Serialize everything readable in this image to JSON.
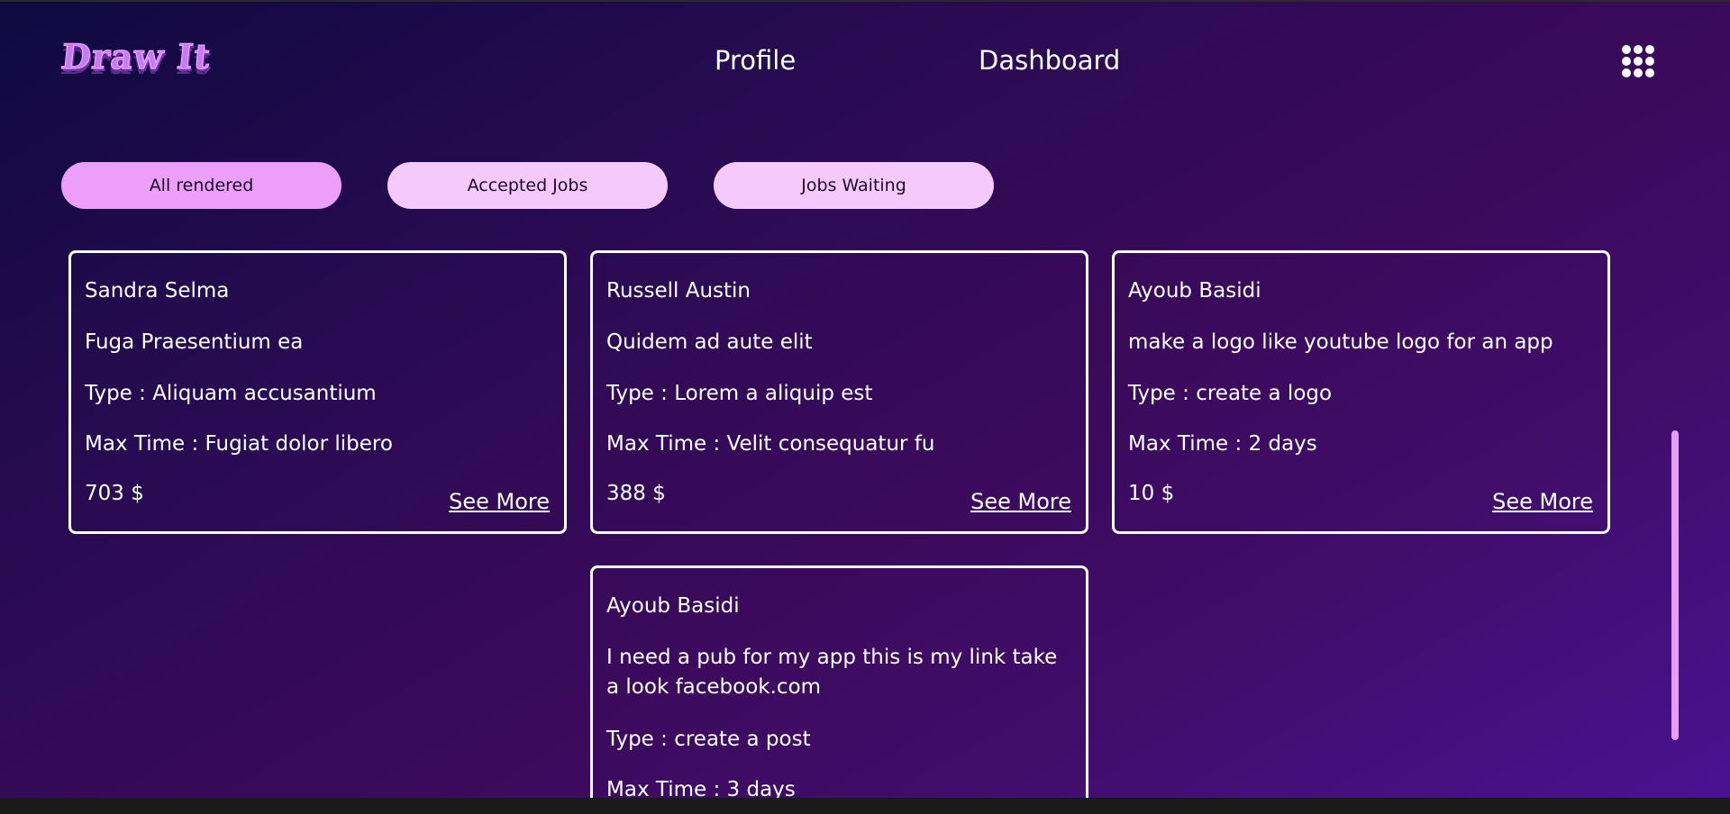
{
  "header": {
    "logo_text": "Draw It",
    "nav": {
      "profile": "Profile",
      "dashboard": "Dashboard"
    },
    "menu_icon": "apps-grid-icon"
  },
  "filters": {
    "all": "All rendered",
    "accepted": "Accepted Jobs",
    "waiting": "Jobs Waiting",
    "active": "All rendered"
  },
  "jobs": [
    {
      "client": "Sandra Selma",
      "title": "Fuga Praesentium ea",
      "type": "Type : Aliquam accusantium",
      "max_time": "Max Time : Fugiat dolor libero",
      "price": "703 $",
      "see_more": "See More"
    },
    {
      "client": "Russell Austin",
      "title": "Quidem ad aute elit",
      "type": "Type : Lorem a aliquip est",
      "max_time": "Max Time : Velit consequatur fu",
      "price": "388 $",
      "see_more": "See More"
    },
    {
      "client": "Ayoub Basidi",
      "title": "make a logo like youtube logo for an app",
      "type": "Type : create a logo",
      "max_time": "Max Time : 2 days",
      "price": "10 $",
      "see_more": "See More"
    },
    {
      "client": "Ayoub Basidi",
      "title": "I need a pub for my app this is my link take a look facebook.com",
      "type": "Type : create a post",
      "max_time": "Max Time : 3 days"
    }
  ],
  "colors": {
    "accent_pink": "#ec9ff9",
    "accent_pink_light": "#f6c9fc",
    "background_start": "#0f0a40",
    "background_end": "#4a1290",
    "text": "#ffffff"
  }
}
